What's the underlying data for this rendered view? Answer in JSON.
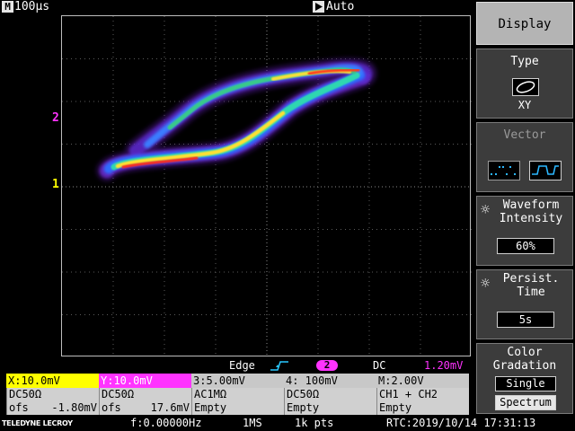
{
  "topbar": {
    "timebase_label": "100µs",
    "trigger_mode": "Auto"
  },
  "markers": {
    "ch2": "2",
    "ch1": "1"
  },
  "trigger": {
    "type": "Edge",
    "source": "2",
    "coupling": "DC",
    "level": "1.20mV"
  },
  "channels": [
    {
      "head": "X:10.0mV",
      "head_color": "#ffff00",
      "head_text": "#000000",
      "row1": "DC50Ω",
      "row2_label": "ofs",
      "row2_value": "-1.80mV"
    },
    {
      "head": "Y:10.0mV",
      "head_color": "#ff33ff",
      "head_text": "#ffffff",
      "row1": "DC50Ω",
      "row2_label": "ofs",
      "row2_value": "17.6mV"
    },
    {
      "head": "3:5.00mV",
      "head_color": "#c8c8c8",
      "head_text": "#000000",
      "row1": "AC1MΩ",
      "row2_label": "Empty",
      "row2_value": ""
    },
    {
      "head": "4: 100mV",
      "head_color": "#c8c8c8",
      "head_text": "#000000",
      "row1": "DC50Ω",
      "row2_label": "Empty",
      "row2_value": ""
    },
    {
      "head": "M:2.00V",
      "head_color": "#c8c8c8",
      "head_text": "#000000",
      "row1": "CH1 + CH2",
      "row2_label": "Empty",
      "row2_value": ""
    }
  ],
  "status": {
    "brand": "TELEDYNE LECROY",
    "frequency": "f:0.00000Hz",
    "sample_rate": "1MS",
    "points": "1k pts",
    "rtc": "RTC:2019/10/14 17:31:13"
  },
  "panel": {
    "display": "Display",
    "type_title": "Type",
    "type_value": "XY",
    "vector_title": "Vector",
    "intensity_title_1": "Waveform",
    "intensity_title_2": "Intensity",
    "intensity_value": "60%",
    "persist_title_1": "Persist.",
    "persist_title_2": "Time",
    "persist_value": "5s",
    "color_title_1": "Color",
    "color_title_2": "Gradation",
    "color_opt_1": "Single",
    "color_opt_2": "Spectrum"
  },
  "colors": {
    "ch1": "#ffff00",
    "ch2": "#ff33ff",
    "panel_active": "#b4b4b4",
    "panel_bg": "#3c3c3c"
  }
}
